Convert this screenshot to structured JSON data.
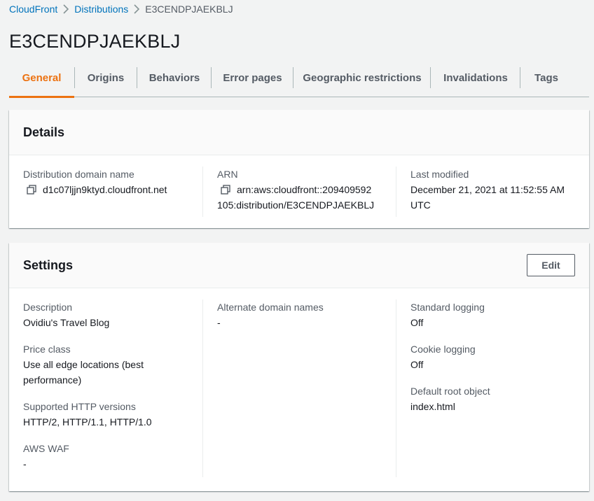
{
  "breadcrumb": {
    "items": [
      "CloudFront",
      "Distributions"
    ],
    "current": "E3CENDPJAEKBLJ"
  },
  "page_title": "E3CENDPJAEKBLJ",
  "tabs": [
    {
      "label": "General",
      "active": true
    },
    {
      "label": "Origins",
      "active": false
    },
    {
      "label": "Behaviors",
      "active": false
    },
    {
      "label": "Error pages",
      "active": false
    },
    {
      "label": "Geographic restrictions",
      "active": false
    },
    {
      "label": "Invalidations",
      "active": false
    },
    {
      "label": "Tags",
      "active": false
    }
  ],
  "details": {
    "title": "Details",
    "domain_label": "Distribution domain name",
    "domain_value": "d1c07ljjn9ktyd.cloudfront.net",
    "arn_label": "ARN",
    "arn_line1": "arn:aws:cloudfront::209409592",
    "arn_line2": "105:distribution/E3CENDPJAEKBLJ",
    "modified_label": "Last modified",
    "modified_line1": "December 21, 2021 at 11:52:55 AM",
    "modified_line2": "UTC"
  },
  "settings": {
    "title": "Settings",
    "edit_label": "Edit",
    "description_label": "Description",
    "description_value": "Ovidiu's Travel Blog",
    "price_label": "Price class",
    "price_line1": "Use all edge locations (best",
    "price_line2": "performance)",
    "http_label": "Supported HTTP versions",
    "http_value": "HTTP/2, HTTP/1.1, HTTP/1.0",
    "waf_label": "AWS WAF",
    "waf_value": "-",
    "alt_label": "Alternate domain names",
    "alt_value": "-",
    "std_log_label": "Standard logging",
    "std_log_value": "Off",
    "cookie_label": "Cookie logging",
    "cookie_value": "Off",
    "root_label": "Default root object",
    "root_value": "index.html"
  },
  "colors": {
    "accent": "#ec7211",
    "link": "#0073bb",
    "muted": "#545b64"
  }
}
